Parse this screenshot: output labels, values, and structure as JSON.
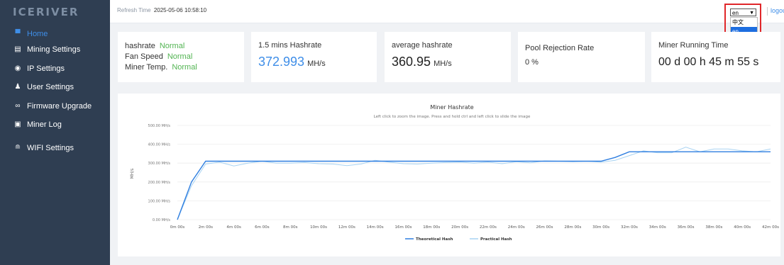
{
  "app": {
    "logo": "ICERIVER"
  },
  "sidebar": {
    "items": [
      {
        "label": "Home",
        "icon": "monitor-icon",
        "active": true
      },
      {
        "label": "Mining Settings",
        "icon": "server-icon"
      },
      {
        "label": "IP Settings",
        "icon": "location-pin-icon"
      },
      {
        "label": "User Settings",
        "icon": "user-icon"
      },
      {
        "label": "Firmware Upgrade",
        "icon": "link-icon"
      },
      {
        "label": "Miner Log",
        "icon": "document-icon"
      },
      {
        "label": "WIFI Settings",
        "icon": "wifi-icon"
      }
    ]
  },
  "header": {
    "refresh_label": "Refresh Time",
    "refresh_time": "2025-05-06 10:58:10",
    "language": {
      "selected": "en",
      "options": [
        "中文",
        "en"
      ]
    },
    "logout": "logout"
  },
  "status": {
    "hashrate_label": "hashrate",
    "hashrate_state": "Normal",
    "fan_label": "Fan Speed",
    "fan_state": "Normal",
    "temp_label": "Miner Temp.",
    "temp_state": "Normal"
  },
  "stats": {
    "hashrate_15": {
      "title": "1.5 mins Hashrate",
      "value": "372.993",
      "unit": "MH/s"
    },
    "average": {
      "title": "average hashrate",
      "value": "360.95",
      "unit": "MH/s"
    },
    "rejection": {
      "title": "Pool Rejection Rate",
      "value": "0 %"
    },
    "runtime": {
      "title": "Miner Running Time",
      "value": "00 d 00 h 45 m 55 s"
    }
  },
  "colors": {
    "accent": "#3f8ee8",
    "ok": "#52b452",
    "sidebar": "#2f3e52",
    "theoretical": "#2e7ee0",
    "practical": "#a9d3f2"
  },
  "chart_data": {
    "type": "line",
    "title": "Miner Hashrate",
    "subtitle": "Left click to zoom the image. Press and hold ctrl and left click to slide the image",
    "ylabel": "MH/s",
    "ylim": [
      0,
      500
    ],
    "yticks": [
      "0.00 MH/s",
      "100.00 MH/s",
      "200.00 MH/s",
      "300.00 MH/s",
      "400.00 MH/s",
      "500.00 MH/s"
    ],
    "xticks": [
      "0m 00s",
      "2m 00s",
      "4m 00s",
      "6m 00s",
      "8m 00s",
      "10m 00s",
      "12m 00s",
      "14m 00s",
      "16m 00s",
      "18m 00s",
      "20m 00s",
      "22m 00s",
      "24m 00s",
      "26m 00s",
      "28m 00s",
      "30m 00s",
      "32m 00s",
      "34m 00s",
      "36m 00s",
      "38m 00s",
      "40m 00s",
      "42m 00s"
    ],
    "legend": [
      "Theoretical Hash",
      "Practical Hash"
    ],
    "grid": true,
    "legend_position": "bottom",
    "series": [
      {
        "name": "Theoretical Hash",
        "x": [
          0,
          1,
          2,
          4,
          6,
          8,
          10,
          12,
          14,
          16,
          18,
          20,
          22,
          24,
          26,
          28,
          30,
          31,
          32,
          34,
          36,
          38,
          40,
          42
        ],
        "values": [
          0,
          200,
          310,
          310,
          310,
          310,
          310,
          310,
          310,
          310,
          310,
          310,
          310,
          310,
          310,
          310,
          310,
          330,
          360,
          360,
          360,
          360,
          360,
          360
        ]
      },
      {
        "name": "Practical Hash",
        "x": [
          0,
          1,
          2,
          3,
          4,
          5,
          6,
          7,
          8,
          9,
          10,
          11,
          12,
          13,
          14,
          15,
          16,
          17,
          18,
          19,
          20,
          21,
          22,
          23,
          24,
          25,
          26,
          27,
          28,
          29,
          30,
          31,
          32,
          33,
          34,
          35,
          36,
          37,
          38,
          39,
          40,
          41,
          42
        ],
        "values": [
          0,
          180,
          295,
          305,
          285,
          300,
          310,
          300,
          300,
          303,
          297,
          295,
          287,
          295,
          315,
          305,
          297,
          295,
          300,
          303,
          305,
          300,
          305,
          297,
          307,
          302,
          312,
          310,
          307,
          310,
          305,
          315,
          340,
          365,
          355,
          355,
          385,
          360,
          375,
          375,
          365,
          360,
          375
        ]
      }
    ]
  }
}
